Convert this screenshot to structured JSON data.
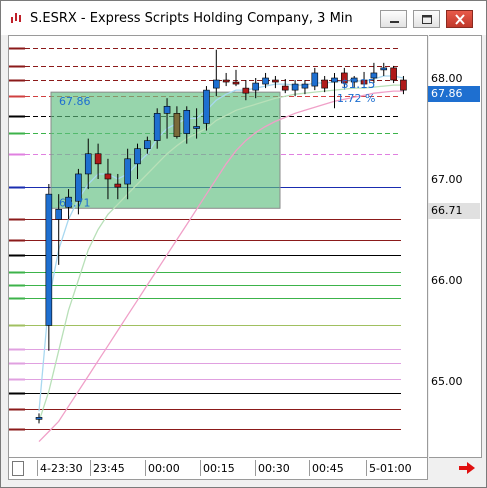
{
  "window": {
    "title": "S.ESRX - Express Scripts Holding Company, 3 Min",
    "controls": [
      "minimize",
      "maximize",
      "close"
    ]
  },
  "price_axis": {
    "ticks": [
      "68.00",
      "67.00",
      "66.00",
      "65.00"
    ],
    "current_price_tag": "67.86",
    "box_low_tag": "66.71"
  },
  "time_axis": {
    "labels": [
      "4-23:30",
      "23:45",
      "00:00",
      "00:15",
      "00:30",
      "00:45",
      "5-01:00"
    ]
  },
  "measure_box": {
    "top_value": "67.86",
    "bottom_value": "66.71",
    "change_value": "$1.15",
    "change_percent": "1.72 %"
  },
  "colors": {
    "up_candle": "#1e6fd0",
    "down_candle": "#b01a1a",
    "neutral_candle": "#7a6a3a",
    "box_fill": "#5fbf7f",
    "current_tag_bg": "#1e6fd0",
    "box_tag_bg": "#e0e0e0"
  },
  "chart_data": {
    "type": "candlestick",
    "y_range": [
      64.2,
      68.4
    ],
    "candles": [
      {
        "o": 64.62,
        "h": 64.68,
        "l": 64.58,
        "c": 64.64
      },
      {
        "o": 65.55,
        "h": 66.95,
        "l": 65.3,
        "c": 66.85
      },
      {
        "o": 66.6,
        "h": 66.85,
        "l": 66.15,
        "c": 66.7
      },
      {
        "o": 66.72,
        "h": 66.9,
        "l": 66.6,
        "c": 66.82
      },
      {
        "o": 66.78,
        "h": 67.1,
        "l": 66.65,
        "c": 67.05
      },
      {
        "o": 67.05,
        "h": 67.4,
        "l": 66.9,
        "c": 67.25
      },
      {
        "o": 67.25,
        "h": 67.35,
        "l": 67.0,
        "c": 67.15
      },
      {
        "o": 67.05,
        "h": 67.2,
        "l": 66.8,
        "c": 67.0
      },
      {
        "o": 66.95,
        "h": 67.05,
        "l": 66.8,
        "c": 66.92
      },
      {
        "o": 66.95,
        "h": 67.3,
        "l": 66.8,
        "c": 67.2
      },
      {
        "o": 67.15,
        "h": 67.35,
        "l": 67.0,
        "c": 67.3
      },
      {
        "o": 67.3,
        "h": 67.42,
        "l": 67.25,
        "c": 67.38
      },
      {
        "o": 67.38,
        "h": 67.7,
        "l": 67.3,
        "c": 67.65
      },
      {
        "o": 67.65,
        "h": 67.8,
        "l": 67.4,
        "c": 67.72
      },
      {
        "o": 67.65,
        "h": 67.72,
        "l": 67.4,
        "c": 67.42
      },
      {
        "o": 67.45,
        "h": 67.72,
        "l": 67.35,
        "c": 67.68
      },
      {
        "o": 67.5,
        "h": 67.7,
        "l": 67.4,
        "c": 67.52
      },
      {
        "o": 67.55,
        "h": 67.92,
        "l": 67.48,
        "c": 67.88
      },
      {
        "o": 67.9,
        "h": 68.28,
        "l": 67.82,
        "c": 67.98
      },
      {
        "o": 67.98,
        "h": 68.05,
        "l": 67.92,
        "c": 67.96
      },
      {
        "o": 67.96,
        "h": 68.08,
        "l": 67.92,
        "c": 67.94
      },
      {
        "o": 67.9,
        "h": 67.98,
        "l": 67.78,
        "c": 67.85
      },
      {
        "o": 67.88,
        "h": 68.0,
        "l": 67.8,
        "c": 67.95
      },
      {
        "o": 67.94,
        "h": 68.05,
        "l": 67.9,
        "c": 68.0
      },
      {
        "o": 67.98,
        "h": 68.02,
        "l": 67.9,
        "c": 67.96
      },
      {
        "o": 67.92,
        "h": 67.99,
        "l": 67.85,
        "c": 67.88
      },
      {
        "o": 67.88,
        "h": 67.98,
        "l": 67.82,
        "c": 67.94
      },
      {
        "o": 67.9,
        "h": 67.98,
        "l": 67.84,
        "c": 67.94
      },
      {
        "o": 67.92,
        "h": 68.1,
        "l": 67.88,
        "c": 68.05
      },
      {
        "o": 67.98,
        "h": 68.02,
        "l": 67.86,
        "c": 67.9
      },
      {
        "o": 67.96,
        "h": 68.05,
        "l": 67.7,
        "c": 68.0
      },
      {
        "o": 68.05,
        "h": 68.1,
        "l": 67.9,
        "c": 67.95
      },
      {
        "o": 67.96,
        "h": 68.02,
        "l": 67.9,
        "c": 68.0
      },
      {
        "o": 67.98,
        "h": 68.06,
        "l": 67.9,
        "c": 67.94
      },
      {
        "o": 68.0,
        "h": 68.15,
        "l": 67.95,
        "c": 68.05
      },
      {
        "o": 68.08,
        "h": 68.15,
        "l": 68.02,
        "c": 68.1
      },
      {
        "o": 68.1,
        "h": 68.12,
        "l": 67.95,
        "c": 67.98
      },
      {
        "o": 67.98,
        "h": 68.02,
        "l": 67.84,
        "c": 67.88
      }
    ],
    "horizontal_levels": [
      {
        "price": 68.3,
        "color": "#8b1a1a",
        "dash": true
      },
      {
        "price": 68.12,
        "color": "#8b1a1a",
        "dash": true
      },
      {
        "price": 67.98,
        "color": "#8b1a1a",
        "dash": true
      },
      {
        "price": 67.82,
        "color": "#d04040",
        "dash": true
      },
      {
        "price": 67.62,
        "color": "#000000",
        "dash": true
      },
      {
        "price": 67.46,
        "color": "#3cb34a",
        "dash": true
      },
      {
        "price": 67.25,
        "color": "#e080e0",
        "dash": true
      },
      {
        "price": 66.92,
        "color": "#1a2db0",
        "dash": false
      },
      {
        "price": 66.6,
        "color": "#8b1a1a",
        "dash": false
      },
      {
        "price": 66.4,
        "color": "#8b1a1a",
        "dash": false
      },
      {
        "price": 66.25,
        "color": "#000000",
        "dash": false
      },
      {
        "price": 66.08,
        "color": "#3cb34a",
        "dash": false
      },
      {
        "price": 65.95,
        "color": "#3cb34a",
        "dash": false
      },
      {
        "price": 65.82,
        "color": "#3cb34a",
        "dash": false
      },
      {
        "price": 65.55,
        "color": "#a0c060",
        "dash": false
      },
      {
        "price": 65.32,
        "color": "#e0a0e0",
        "dash": false
      },
      {
        "price": 65.18,
        "color": "#e0a0e0",
        "dash": false
      },
      {
        "price": 65.02,
        "color": "#e0a0e0",
        "dash": false
      },
      {
        "price": 64.88,
        "color": "#000000",
        "dash": false
      },
      {
        "price": 64.72,
        "color": "#8b1a1a",
        "dash": false
      },
      {
        "price": 64.52,
        "color": "#8b1a1a",
        "dash": false
      }
    ],
    "moving_averages": [
      {
        "color": "#a8d8f0",
        "values": [
          64.7,
          65.8,
          66.3,
          66.6,
          66.8,
          66.95,
          67.05,
          67.05,
          67.0,
          67.05,
          67.15,
          67.25,
          67.4,
          67.5,
          67.55,
          67.6,
          67.6,
          67.68,
          67.78,
          67.84,
          67.88,
          67.88,
          67.9,
          67.92,
          67.94,
          67.94,
          67.93,
          67.93,
          67.95,
          67.95,
          67.96,
          67.97,
          67.97,
          67.97,
          67.99,
          68.02,
          68.02,
          68.0
        ]
      },
      {
        "color": "#b8e0b8",
        "values": [
          64.6,
          64.9,
          65.3,
          65.7,
          66.0,
          66.3,
          66.5,
          66.65,
          66.75,
          66.85,
          66.95,
          67.05,
          67.15,
          67.25,
          67.33,
          67.4,
          67.45,
          67.5,
          67.58,
          67.63,
          67.68,
          67.71,
          67.74,
          67.77,
          67.8,
          67.82,
          67.84,
          67.85,
          67.86,
          67.87,
          67.88,
          67.89,
          67.9,
          67.9,
          67.91,
          67.92,
          67.93,
          67.93
        ]
      },
      {
        "color": "#f0a0c8",
        "values": [
          64.4,
          64.5,
          64.6,
          64.75,
          64.9,
          65.05,
          65.2,
          65.35,
          65.5,
          65.65,
          65.8,
          65.95,
          66.1,
          66.25,
          66.4,
          66.55,
          66.7,
          66.85,
          67.0,
          67.15,
          67.28,
          67.38,
          67.46,
          67.52,
          67.57,
          67.61,
          67.65,
          67.68,
          67.71,
          67.74,
          67.77,
          67.79,
          67.81,
          67.83,
          67.85,
          67.86,
          67.87,
          67.87
        ]
      }
    ]
  }
}
